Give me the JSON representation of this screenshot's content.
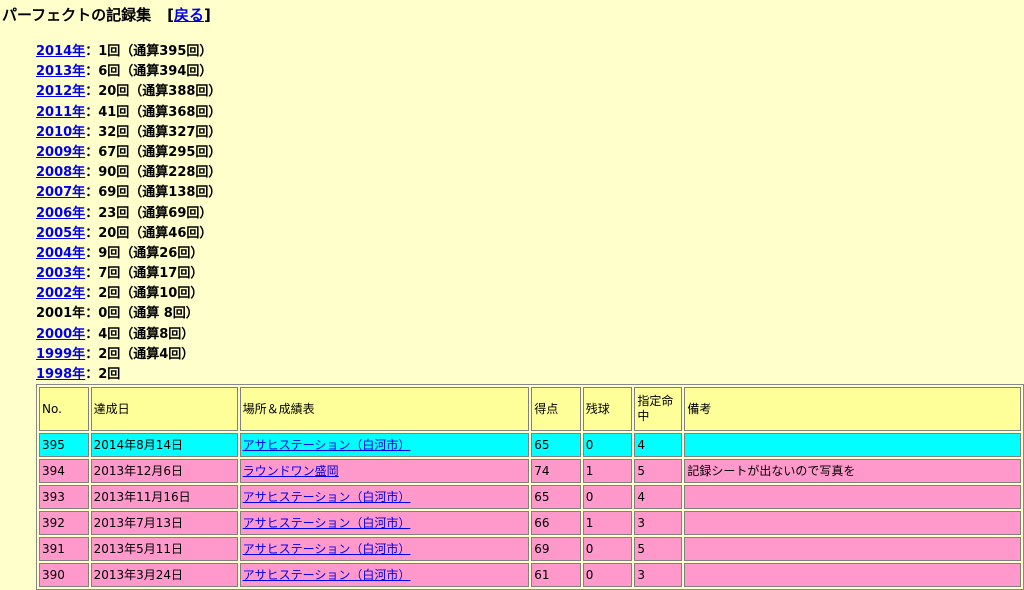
{
  "header": {
    "title": "パーフェクトの記録集",
    "back_open": "[",
    "back_label": "戻る",
    "back_close": "]"
  },
  "years": [
    {
      "year": "2014年",
      "link": true,
      "text": "：1回（通算395回）"
    },
    {
      "year": "2013年",
      "link": true,
      "text": "：6回（通算394回）"
    },
    {
      "year": "2012年",
      "link": true,
      "text": "：20回（通算388回）"
    },
    {
      "year": "2011年",
      "link": true,
      "text": "：41回（通算368回）"
    },
    {
      "year": "2010年",
      "link": true,
      "text": "：32回（通算327回）"
    },
    {
      "year": "2009年",
      "link": true,
      "text": "：67回（通算295回）"
    },
    {
      "year": "2008年",
      "link": true,
      "text": "：90回（通算228回）"
    },
    {
      "year": "2007年",
      "link": true,
      "text": "：69回（通算138回）"
    },
    {
      "year": "2006年",
      "link": true,
      "text": "：23回（通算69回）"
    },
    {
      "year": "2005年",
      "link": true,
      "text": "：20回（通算46回）"
    },
    {
      "year": "2004年",
      "link": true,
      "text": "：9回（通算26回）"
    },
    {
      "year": "2003年",
      "link": true,
      "text": "：7回（通算17回）"
    },
    {
      "year": "2002年",
      "link": true,
      "text": "：2回（通算10回）"
    },
    {
      "year": "2001年",
      "link": false,
      "text": "：0回（通算 8回）"
    },
    {
      "year": "2000年",
      "link": true,
      "text": "：4回（通算8回）"
    },
    {
      "year": "1999年",
      "link": true,
      "text": "：2回（通算4回）"
    },
    {
      "year": "1998年",
      "link": true,
      "text": "：2回"
    }
  ],
  "table": {
    "headers": {
      "no": "No.",
      "date": "達成日",
      "place": "場所＆成績表",
      "score": "得点",
      "remaining": "残球",
      "hit": "指定命中",
      "notes": "備考"
    },
    "rows": [
      {
        "no": "395",
        "date": "2014年8月14日",
        "place": "アサヒステーション（白河市）",
        "score": "65",
        "remaining": "0",
        "hit": "4",
        "notes": "",
        "color": "cyan"
      },
      {
        "no": "394",
        "date": "2013年12月6日",
        "place": "ラウンドワン盛岡",
        "score": "74",
        "remaining": "1",
        "hit": "5",
        "notes": "記録シートが出ないので写真を",
        "color": "pink"
      },
      {
        "no": "393",
        "date": "2013年11月16日",
        "place": "アサヒステーション（白河市）",
        "score": "65",
        "remaining": "0",
        "hit": "4",
        "notes": "",
        "color": "pink"
      },
      {
        "no": "392",
        "date": "2013年7月13日",
        "place": "アサヒステーション（白河市）",
        "score": "66",
        "remaining": "1",
        "hit": "3",
        "notes": "",
        "color": "pink"
      },
      {
        "no": "391",
        "date": "2013年5月11日",
        "place": "アサヒステーション（白河市）",
        "score": "69",
        "remaining": "0",
        "hit": "5",
        "notes": "",
        "color": "pink"
      },
      {
        "no": "390",
        "date": "2013年3月24日",
        "place": "アサヒステーション（白河市）",
        "score": "61",
        "remaining": "0",
        "hit": "3",
        "notes": "",
        "color": "pink"
      }
    ]
  },
  "colors": {
    "background": "#ffffcc",
    "header_row": "#ffff99",
    "latest_row": "#00ffff",
    "row": "#ff99cc",
    "link": "#0000ee"
  }
}
